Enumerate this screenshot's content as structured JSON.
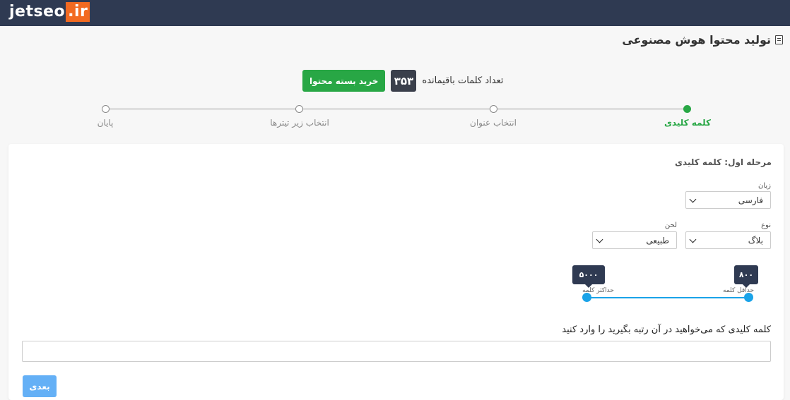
{
  "header": {
    "logo_main": "jetseo",
    "logo_highlight": ".ir"
  },
  "page": {
    "title": "تولید محتوا هوش مصنوعی",
    "title_icon": "book-icon"
  },
  "credits": {
    "label": "تعداد کلمات باقیمانده",
    "count": "۳۵۳",
    "buy_button": "خرید بسته محتوا"
  },
  "stepper": {
    "steps": [
      {
        "label": "کلمه کلیدی",
        "active": true
      },
      {
        "label": "انتخاب عنوان",
        "active": false
      },
      {
        "label": "انتخاب زیر تیترها",
        "active": false
      },
      {
        "label": "پایان",
        "active": false
      }
    ]
  },
  "form": {
    "section_title": "مرحله اول: کلمه کلیدی",
    "language": {
      "label": "زبان",
      "value": "فارسی"
    },
    "type": {
      "label": "نوع",
      "value": "بلاگ"
    },
    "tone": {
      "label": "لحن",
      "value": "طبیعی"
    },
    "range": {
      "min_value": "۸۰۰",
      "min_caption": "حداقل کلمه",
      "max_value": "۵۰۰۰",
      "max_caption": "حداکثر کلمه"
    },
    "keyword_label": "کلمه کلیدی که می‌خواهید در آن رتبه بگیرید را وارد کنید",
    "keyword_value": "",
    "next_button": "بعدی"
  },
  "colors": {
    "topbar": "#2f3a52",
    "accent_green": "#28a745",
    "slider_blue": "#1aa3e8",
    "logo_orange": "#f26a21"
  }
}
